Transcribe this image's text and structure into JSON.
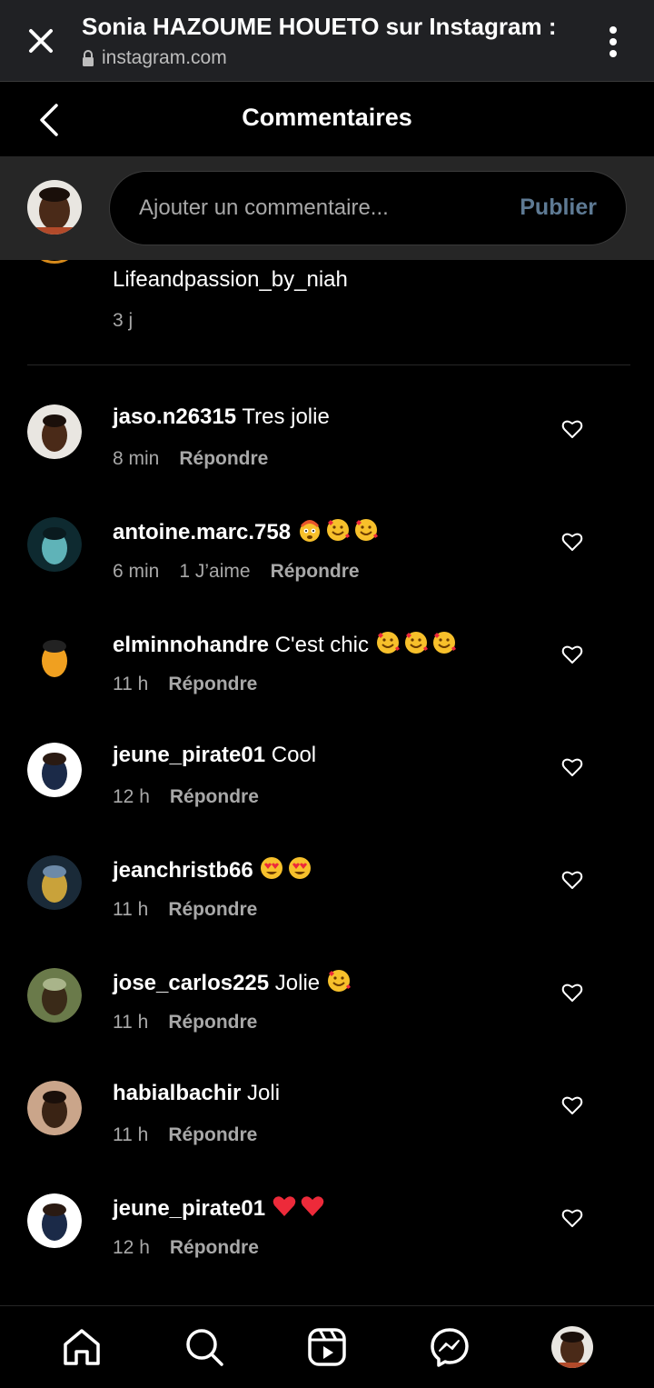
{
  "browser": {
    "title": "Sonia HAZOUME HOUETO sur Instagram :",
    "url": "instagram.com"
  },
  "header": {
    "title": "Commentaires"
  },
  "composer": {
    "placeholder": "Ajouter un commentaire...",
    "post_label": "Publier"
  },
  "previous_comment": {
    "text": "Lifeandpassion_by_niah",
    "time": "3 j"
  },
  "comments": [
    {
      "user": "jaso.n26315",
      "text": "Tres jolie",
      "emojis": [],
      "time": "8 min",
      "likes": "",
      "reply": "Répondre"
    },
    {
      "user": "antoine.marc.758",
      "text": "",
      "emojis": [
        "mind-blown",
        "smiling-hearts",
        "smiling-hearts"
      ],
      "time": "6 min",
      "likes": "1 J’aime",
      "reply": "Répondre"
    },
    {
      "user": "elminnohandre",
      "text": "C'est chic",
      "emojis": [
        "smiling-hearts",
        "smiling-hearts",
        "smiling-hearts"
      ],
      "time": "11 h",
      "likes": "",
      "reply": "Répondre"
    },
    {
      "user": "jeune_pirate01",
      "text": "Cool",
      "emojis": [],
      "time": "12 h",
      "likes": "",
      "reply": "Répondre"
    },
    {
      "user": "jeanchristb66",
      "text": "",
      "emojis": [
        "heart-eyes",
        "heart-eyes"
      ],
      "time": "11 h",
      "likes": "",
      "reply": "Répondre"
    },
    {
      "user": "jose_carlos225",
      "text": "Jolie",
      "emojis": [
        "smiling-hearts"
      ],
      "time": "11 h",
      "likes": "",
      "reply": "Répondre"
    },
    {
      "user": "habialbachir",
      "text": "Joli",
      "emojis": [],
      "time": "11 h",
      "likes": "",
      "reply": "Répondre"
    },
    {
      "user": "jeune_pirate01",
      "text": "",
      "emojis": [
        "red-heart",
        "red-heart"
      ],
      "time": "12 h",
      "likes": "",
      "reply": "Répondre"
    }
  ],
  "nav": [
    "home-icon",
    "search-icon",
    "reels-icon",
    "messenger-icon",
    "profile-avatar"
  ],
  "colors": {
    "background": "#000000",
    "composer_bg": "#262626",
    "muted": "#a8a8a8",
    "publish": "#5e7a94",
    "heart": "#ed2a3a",
    "emoji": "#f7c02b"
  }
}
